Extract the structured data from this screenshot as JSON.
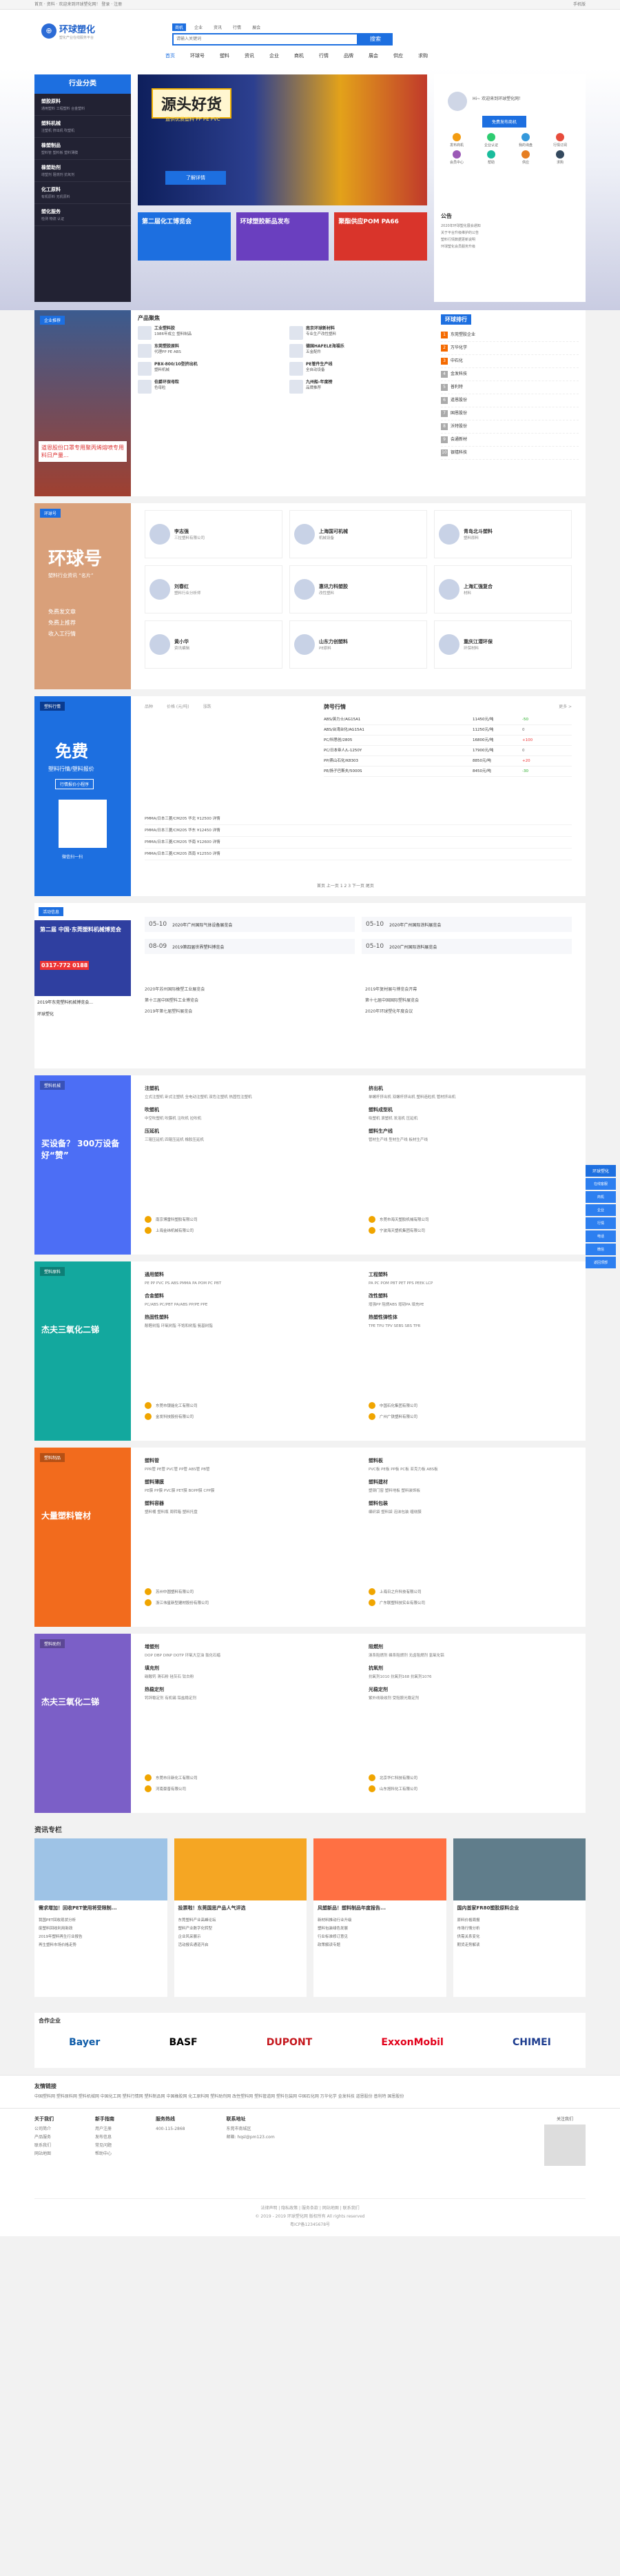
{
  "topbar": {
    "text": "首页 · 资料 · 欢迎来到环球塑化网！ 登录 · 注册",
    "right": "手机版"
  },
  "header": {
    "logo_name": "环球塑化",
    "logo_slogan": "塑化产业在线服务平台",
    "search_tabs": [
      "商机",
      "企业",
      "资讯",
      "行情",
      "展会"
    ],
    "search_placeholder": "请输入关键词",
    "search_button": "搜索",
    "nav": [
      "首页",
      "环球号",
      "塑料",
      "资讯",
      "企业",
      "商机",
      "行情",
      "品牌",
      "展会",
      "供应",
      "求购"
    ]
  },
  "categories": {
    "title": "行业分类",
    "items": [
      {
        "name": "塑胶原料",
        "sub": "通用塑料 工程塑料 合金塑料"
      },
      {
        "name": "塑料机械",
        "sub": "注塑机 挤出机 吹塑机"
      },
      {
        "name": "橡塑制品",
        "sub": "塑料管 塑料板 塑料薄膜"
      },
      {
        "name": "橡塑助剂",
        "sub": "增塑剂 阻燃剂 抗氧剂"
      },
      {
        "name": "化工原料",
        "sub": "有机原料 无机原料"
      },
      {
        "name": "塑化服务",
        "sub": "检测 物流 认证"
      }
    ]
  },
  "banner": {
    "title": "源头好货",
    "sub": "直供优质塑料 PP PE PVC",
    "button": "了解详情"
  },
  "mini_banners": [
    {
      "text": "第二届化工博览会",
      "color": "#1d6fe0"
    },
    {
      "text": "环球塑胶新品发布",
      "color": "#6a3fbf"
    },
    {
      "text": "聚酯供应POM PA66",
      "color": "#d9342b"
    }
  ],
  "user": {
    "greet": "Hi~ 欢迎来到环球塑化网！",
    "button": "免费发布商机",
    "quick": [
      "发布商机",
      "企业认证",
      "我的询盘",
      "行情订阅",
      "会员中心",
      "帮助",
      "供应",
      "求购"
    ]
  },
  "notice": {
    "title": "公告",
    "items": [
      "2020年环球塑化展会通知",
      "关于平台升级维护的公告",
      "塑料行情数据更新说明",
      "环球塑化会员服务升级"
    ]
  },
  "products": {
    "tag": "企业推荐",
    "title": "产品聚焦",
    "left_caption": "道恩股份口罩专用聚丙烯熔喷专用料日产量...",
    "items": [
      {
        "name": "工业塑料胶",
        "desc": "1986年成立 塑料制品"
      },
      {
        "name": "南京环球新材料",
        "desc": "专业生产改性塑料"
      },
      {
        "name": "东莞塑胶原料",
        "desc": "代理PP PE ABS"
      },
      {
        "name": "德国HAFELE海福乐",
        "desc": "五金配件"
      },
      {
        "name": "PBX-800/10型挤出机",
        "desc": "塑料机械"
      },
      {
        "name": "PE管件生产线",
        "desc": "全自动设备"
      },
      {
        "name": "伯爵环保母粒",
        "desc": "色母粒"
      },
      {
        "name": "九州船-年度榜",
        "desc": "品牌推荐"
      }
    ],
    "ranking_title": "环球排行",
    "ranking_tabs": [
      "企业",
      "产品"
    ],
    "ranking": [
      "东莞塑胶企业",
      "万华化学",
      "中石化",
      "金发科技",
      "普利特",
      "道恩股份",
      "国恩股份",
      "沃特股份",
      "会通新材",
      "银禧科技"
    ]
  },
  "huanqiu": {
    "title": "环球号",
    "slogan1": "塑料行业资讯 “名片”",
    "benefits": [
      "免费发文章",
      "免费上推荐",
      "收入工行情"
    ],
    "people": [
      {
        "name": "李志强",
        "desc": "三拉塑料有限公司"
      },
      {
        "name": "上海国可机械",
        "desc": "机械设备"
      },
      {
        "name": "青岛北斗塑料",
        "desc": "塑料原料"
      },
      {
        "name": "刘春红",
        "desc": "塑料行业分析师"
      },
      {
        "name": "惠讯力科塑胶",
        "desc": "改性塑料"
      },
      {
        "name": "上海汇强复合",
        "desc": "材料"
      },
      {
        "name": "黄小华",
        "desc": "资讯编辑"
      },
      {
        "name": "山东力创塑料",
        "desc": "PE原料"
      },
      {
        "name": "重庆江潜环保",
        "desc": "环保材料"
      }
    ]
  },
  "quotes": {
    "tag": "塑料行情",
    "promo_title": "免费",
    "promo_sub": "塑料行情/塑料报价",
    "promo_mini": "行情报价小程序",
    "promo_scan": "微信扫一扫",
    "headers": [
      "品种",
      "价格 (元/吨)",
      "涨跌"
    ],
    "table_title": "牌号行情",
    "table_more": "更多 >",
    "rows": [
      [
        "ABS/英力士/AG15A1",
        "11450元/吨",
        "-50"
      ],
      [
        "ABS/台湾台化/AG15A1",
        "11250元/吨",
        "0"
      ],
      [
        "PC/科思创/2805",
        "16800元/吨",
        "+100"
      ],
      [
        "PC/日本帝人/L-1250Y",
        "17900元/吨",
        "0"
      ],
      [
        "PP/燕山石化/K8303",
        "8850元/吨",
        "+20"
      ],
      [
        "PE/扬子巴斯夫/5000S",
        "8450元/吨",
        "-30"
      ]
    ],
    "list": [
      "PMMA/日本三菱/CM205  华北  ¥12500  详情",
      "PMMA/日本三菱/CM205  华东  ¥12450  详情",
      "PMMA/日本三菱/CM205  华南  ¥12600  详情",
      "PMMA/日本三菱/CM205  西南  ¥12550  详情"
    ],
    "pager": "首页 上一页 1 2 3 下一页 尾页"
  },
  "activities": {
    "tag": "活动信息",
    "poster_title": "第二届 中国·东莞塑料机械博览会",
    "poster_phone": "0317-772 0188",
    "poster_caption": "2019年东莞塑料机械博览会...",
    "org": "环球塑化",
    "dates": [
      {
        "date": "05-10",
        "title": "2020年广州国际气体设备展览会"
      },
      {
        "date": "05-10",
        "title": "2020年广州国际涂料展览会"
      },
      {
        "date": "08-09",
        "title": "2019第四届世界塑料博览会"
      },
      {
        "date": "05-10",
        "title": "2020广州国际涂料展览会"
      }
    ],
    "news": [
      "2020年苏州国际橡塑工业展览会",
      "2019年复材展与博览会开幕",
      "第十三届中国塑料工业博览会",
      "第十七届中国国际塑料展览会",
      "2019年第七届塑料展览会",
      "2020年环球塑化年度会议"
    ]
  },
  "plastic_machine": {
    "tag": "塑料机械",
    "promo": "买设备？ 300万设备好“赞”",
    "cols": [
      {
        "title": "注塑机",
        "items": "立式注塑机 卧式注塑机 全电动注塑机 双色注塑机 热固性注塑机"
      },
      {
        "title": "挤出机",
        "items": "单螺杆挤出机 双螺杆挤出机 塑料造粒机 管材挤出机"
      },
      {
        "title": "吹塑机",
        "items": "中空吹塑机 吹膜机 注吹机 拉吹机"
      },
      {
        "title": "塑料成型机",
        "items": "吸塑机 滚塑机 发泡机 压延机"
      },
      {
        "title": "压延机",
        "items": "三辊压延机 四辊压延机 橡胶压延机"
      },
      {
        "title": "塑料生产线",
        "items": "管材生产线 型材生产线 板材生产线"
      }
    ],
    "companies": [
      "南京博雷科塑胶有限公司",
      "东莞市海天塑胶机械有限公司",
      "上海金纬机械有限公司",
      "宁波海天塑机集团有限公司"
    ]
  },
  "plastic_material": {
    "tag": "塑料原料",
    "promo": "杰夫三氧化二锑",
    "cols": [
      {
        "title": "通用塑料",
        "items": "PE PP PVC PS ABS PMMA PA POM PC PBT"
      },
      {
        "title": "工程塑料",
        "items": "PA PC POM PBT PET PPS PEEK LCP"
      },
      {
        "title": "合金塑料",
        "items": "PC/ABS PC/PBT PA/ABS PP/PE PPE"
      },
      {
        "title": "改性塑料",
        "items": "增强PP 阻燃ABS 增韧PA 填充PE"
      },
      {
        "title": "热固性塑料",
        "items": "酚醛树脂 环氧树脂 不饱和树脂 氨基树脂"
      },
      {
        "title": "热塑性弹性体",
        "items": "TPE TPU TPV SEBS SBS TPR"
      }
    ],
    "companies": [
      "东莞市银能化工有限公司",
      "中国石化集团有限公司",
      "金发科技股份有限公司",
      "广州广铁塑料有限公司"
    ]
  },
  "plastic_products": {
    "tag": "塑料制品",
    "promo": "大量塑料管材",
    "cols": [
      {
        "title": "塑料管",
        "items": "PPR管 PE管 PVC管 PP管 ABS管 PB管"
      },
      {
        "title": "塑料板",
        "items": "PVC板 PE板 PP板 PC板 亚克力板 ABS板"
      },
      {
        "title": "塑料薄膜",
        "items": "PE膜 PP膜 PVC膜 PET膜 BOPP膜 CPP膜"
      },
      {
        "title": "塑料建材",
        "items": "塑钢门窗 塑料地板 塑料装饰板"
      },
      {
        "title": "塑料容器",
        "items": "塑料桶 塑料瓶 周转箱 塑料托盘"
      },
      {
        "title": "塑料包装",
        "items": "编织袋 塑料袋 泡沫包装 缠绕膜"
      }
    ],
    "companies": [
      "苏州中圆塑料有限公司",
      "上海日之升科技有限公司",
      "浙江伟星新型建材股份有限公司",
      "广东联塑科技实业有限公司"
    ]
  },
  "plastic_additives": {
    "tag": "塑料助剂",
    "promo": "杰夫三氧化二锑",
    "cols": [
      {
        "title": "增塑剂",
        "items": "DOP DBP DINP DOTP 环氧大豆油 氯化石蜡"
      },
      {
        "title": "阻燃剂",
        "items": "溴系阻燃剂 磷系阻燃剂 无卤阻燃剂 氢氧化铝"
      },
      {
        "title": "填充剂",
        "items": "碳酸钙 滑石粉 硅灰石 钛白粉"
      },
      {
        "title": "抗氧剂",
        "items": "抗氧剂1010 抗氧剂168 抗氧剂1076"
      },
      {
        "title": "热稳定剂",
        "items": "钙锌稳定剂 有机锡 铅盐稳定剂"
      },
      {
        "title": "光稳定剂",
        "items": "紫外线吸收剂 受阻胺光稳定剂"
      }
    ],
    "companies": [
      "东莞市日新化工有限公司",
      "北京华仁科技有限公司",
      "河南豪普有限公司",
      "山东旭科化工有限公司"
    ]
  },
  "news": {
    "title": "资讯专栏",
    "cards": [
      {
        "title": "需求增加！回收PET使用将受限制...",
        "items": [
          "我国PET回收现状分析",
          "废塑料回收利用新政",
          "2019年塑料再生行业报告",
          "再生塑料市场价格走势"
        ]
      },
      {
        "title": "投票啦！东莞国思产品人气评选",
        "items": [
          "东莞塑料产业高峰论坛",
          "塑料产业数字化转型",
          "企业风采展示",
          "活动报名通道开启"
        ]
      },
      {
        "title": "风塑新品！塑料制品年度报告...",
        "items": [
          "新材料推动行业升级",
          "塑料包装绿色发展",
          "行业标准修订意见",
          "政策解读专题"
        ]
      },
      {
        "title": "国内首家FR80塑胶原料企业",
        "items": [
          "原料价格周报",
          "市场行情分析",
          "供需关系变化",
          "期货走势解读"
        ]
      }
    ]
  },
  "partners": {
    "title": "合作企业",
    "names": [
      "Bayer",
      "BASF",
      "DUPONT",
      "ExxonMobil",
      "CHIMEI"
    ]
  },
  "links": {
    "title": "友情链接",
    "text": "中国塑料网 塑料原料网 塑料机械网 中国化工网 塑料行情网 塑料制品网 中国橡胶网 化工原料网 塑料助剂网 改性塑料网 塑料管道网 塑料包装网 中国石化网 万华化学 金发科技 道恩股份 普利特 国恩股份"
  },
  "footer": {
    "cols": [
      {
        "title": "关于我们",
        "items": [
          "公司简介",
          "产品服务",
          "联系我们",
          "网站地图"
        ]
      },
      {
        "title": "新手指南",
        "items": [
          "用户注册",
          "发布信息",
          "常见问题",
          "帮助中心"
        ]
      },
      {
        "title": "服务热线",
        "items": [
          "400-115-2868"
        ]
      },
      {
        "title": "联系地址",
        "items": [
          "东莞市南城区",
          "邮箱: hqsl@pm123.com"
        ]
      }
    ],
    "hotline": "400-115-2868",
    "qr_caption": "关注我们",
    "bottom_links": "法律声明 | 隐私政策 | 服务条款 | 网站地图 | 联系我们",
    "copyright": "© 2019 - 2019 环球塑化网 版权所有 All rights reserved",
    "beian": "粤ICP备12345678号"
  },
  "float": {
    "title": "环球塑化",
    "items": [
      "在线客服",
      "商机",
      "企业",
      "行情",
      "电话",
      "微信",
      "返回顶部"
    ]
  }
}
